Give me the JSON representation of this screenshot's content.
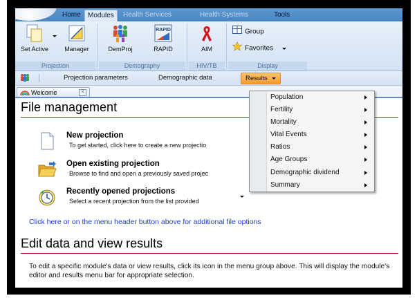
{
  "ribbon": {
    "tabs": [
      {
        "label": "Home"
      },
      {
        "label": "Modules"
      },
      {
        "label": "Health Services"
      },
      {
        "label": "Health Systems"
      },
      {
        "label": "Tools"
      }
    ],
    "groups": {
      "projection": {
        "label": "Projection",
        "set_active": "Set Active",
        "manager": "Manager"
      },
      "demography": {
        "label": "Demography",
        "demproj": "DemProj",
        "rapid": "RAPID"
      },
      "hivtb": {
        "label": "HIV/TB",
        "aim": "AIM"
      },
      "display": {
        "label": "Display",
        "group": "Group",
        "favorites": "Favorites"
      }
    }
  },
  "toolbar": {
    "projection_parameters": "Projection parameters",
    "demographic_data": "Demographic data",
    "results": "Results"
  },
  "doc_tab": {
    "label": "Welcome"
  },
  "welcome": {
    "file_management_title": "File management",
    "new_projection": {
      "title": "New projection",
      "desc": "To get started, click here to create a new projectio"
    },
    "open_projection": {
      "title": "Open existing projection",
      "desc": "Browse to find and open a previously saved projec"
    },
    "recent_projections": {
      "title": "Recently opened projections",
      "desc": "Select a recent projection from the list provided"
    },
    "more_link": "Click here or on the menu header button above for additional file options",
    "edit_title": "Edit data and view results",
    "edit_desc": "To edit a specific module's data or view results, click its icon in the menu group above. This will display the module's editor and results menu bar for appropriate selection."
  },
  "results_menu": {
    "items": [
      {
        "label": "Population"
      },
      {
        "label": "Fertility"
      },
      {
        "label": "Mortality"
      },
      {
        "label": "Vital Events"
      },
      {
        "label": "Ratios"
      },
      {
        "label": "Age Groups"
      },
      {
        "label": "Demographic dividend"
      },
      {
        "label": "Summary"
      }
    ]
  },
  "colors": {
    "accent_blue": "#4a86c3",
    "results_orange": "#f69a2e",
    "heading_rule": "#c8101e",
    "link": "#1a3bd8"
  }
}
